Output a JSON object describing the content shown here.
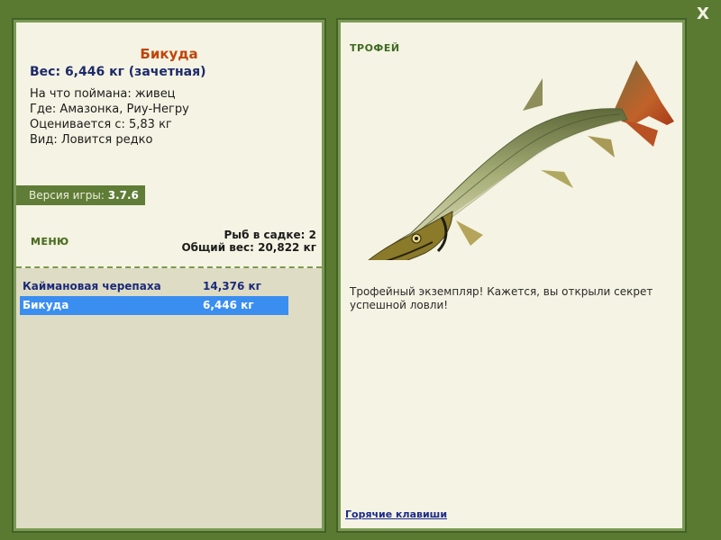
{
  "window": {
    "close_label": "X"
  },
  "fish": {
    "name": "Бикуда",
    "weight_line": "Вес: 6,446 кг (зачетная)",
    "caught_on": "На что поймана: живец",
    "location": "Где: Амазонка, Риу-Негру",
    "valued_from": "Оценивается с: 5,83 кг",
    "kind": "Вид: Ловится редко"
  },
  "version": {
    "label": "Версия игры:",
    "value": "3.7.6"
  },
  "menu": {
    "label": "МЕНЮ"
  },
  "keepnet": {
    "fish_count": "Рыб в садке: 2",
    "total_weight": "Общий вес: 20,822 кг",
    "items": [
      {
        "name": "Каймановая черепаха",
        "weight": "14,376 кг"
      },
      {
        "name": "Бикуда",
        "weight": "6,446 кг"
      }
    ],
    "selected_index": 1
  },
  "trophy": {
    "title": "ТРОФЕЙ",
    "message": "Трофейный экземпляр! Кажется, вы открыли секрет успешной ловли!"
  },
  "hotkeys": {
    "label": "Горячие клавиши"
  },
  "colors": {
    "frame": "#5a7a32",
    "panel_bg": "#f5f3e3",
    "list_bg": "#dedcc4",
    "selected_row": "#3a8ef0",
    "fish_name": "#c0440a"
  },
  "icons": {
    "close": "close-icon",
    "fish": "fish-image"
  }
}
